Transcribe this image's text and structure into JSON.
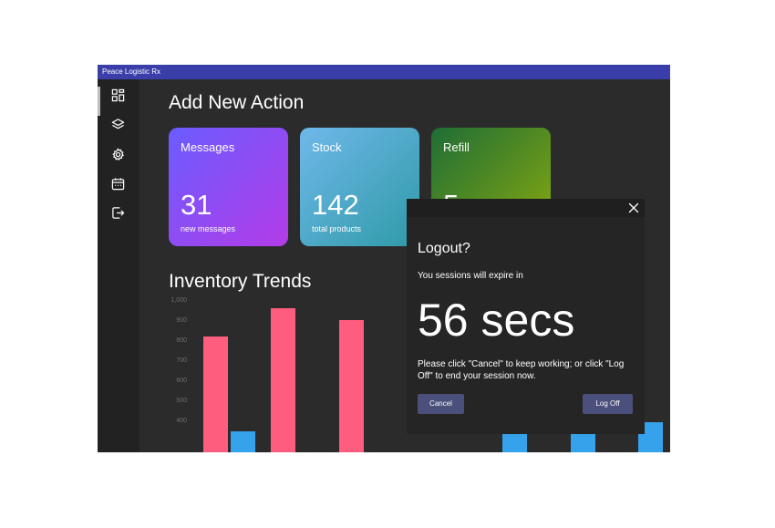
{
  "window": {
    "title": "Peace Logistic Rx"
  },
  "sidebar": {
    "items": [
      {
        "icon": "dashboard-icon"
      },
      {
        "icon": "layers-icon"
      },
      {
        "icon": "gear-icon"
      },
      {
        "icon": "calendar-icon"
      },
      {
        "icon": "logout-icon"
      }
    ]
  },
  "main": {
    "heading": "Add New Action",
    "cards": [
      {
        "title": "Messages",
        "value": "31",
        "subtitle": "new messages"
      },
      {
        "title": "Stock",
        "value": "142",
        "subtitle": "total products"
      },
      {
        "title": "Refill",
        "value": "5",
        "subtitle": ""
      }
    ],
    "chart_heading": "Inventory Trends"
  },
  "chart_data": {
    "type": "bar",
    "title": "Inventory Trends",
    "yticks": [
      "1,000",
      "900",
      "800",
      "700",
      "600",
      "500",
      "400"
    ],
    "ylim": [
      340,
      1000
    ],
    "colors": {
      "pink": "#ff5d7e",
      "blue": "#36a2eb"
    },
    "visible_bars": [
      {
        "series": "pink",
        "value": 825
      },
      {
        "series": "blue",
        "value": 350
      },
      {
        "series": "pink",
        "value": 965
      },
      {
        "series": "pink",
        "value": 905
      },
      {
        "series": "blue",
        "value": 415
      },
      {
        "series": "blue",
        "value": 415
      },
      {
        "series": "blue",
        "value": 395
      }
    ]
  },
  "dialog": {
    "title": "Logout?",
    "expire_text": "You sessions will expire in",
    "countdown": "56 secs",
    "message": "Please click \"Cancel\" to keep working; or click \"Log Off\" to end your session now.",
    "cancel_label": "Cancel",
    "logoff_label": "Log Off"
  },
  "colors": {
    "titlebar": "#3a3ea8",
    "background": "#2b2b2b",
    "sidebar": "#222222",
    "button": "#4a4f7c"
  }
}
